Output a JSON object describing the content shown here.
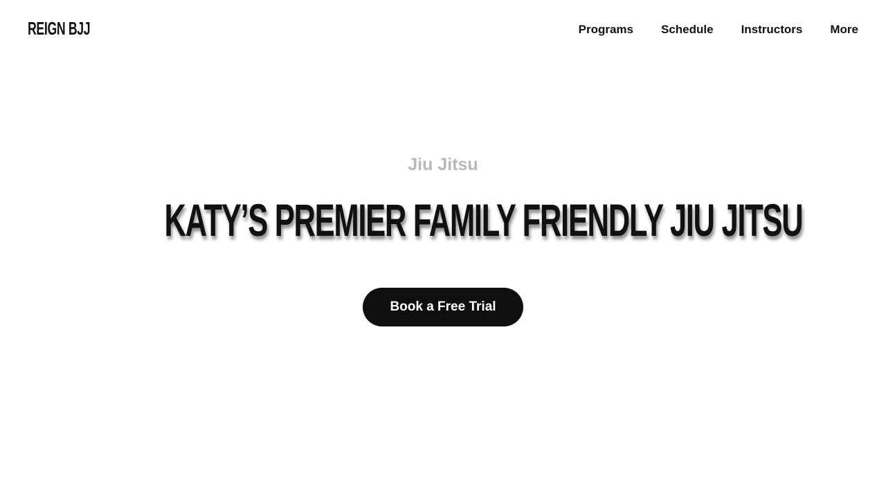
{
  "header": {
    "logo_text": "REIGN BJJ",
    "nav": [
      {
        "label": "Programs"
      },
      {
        "label": "Schedule"
      },
      {
        "label": "Instructors"
      },
      {
        "label": "More"
      }
    ]
  },
  "hero": {
    "eyebrow": "Jiu Jitsu",
    "headline": "KATY’S PREMIER FAMILY FRIENDLY JIU JITSU",
    "cta_label": "Book a Free Trial"
  },
  "colors": {
    "background": "#ffffff",
    "text": "#111111",
    "eyebrow": "#b8b8b8",
    "button": "#0f0f0f",
    "button_text": "#ffffff"
  }
}
